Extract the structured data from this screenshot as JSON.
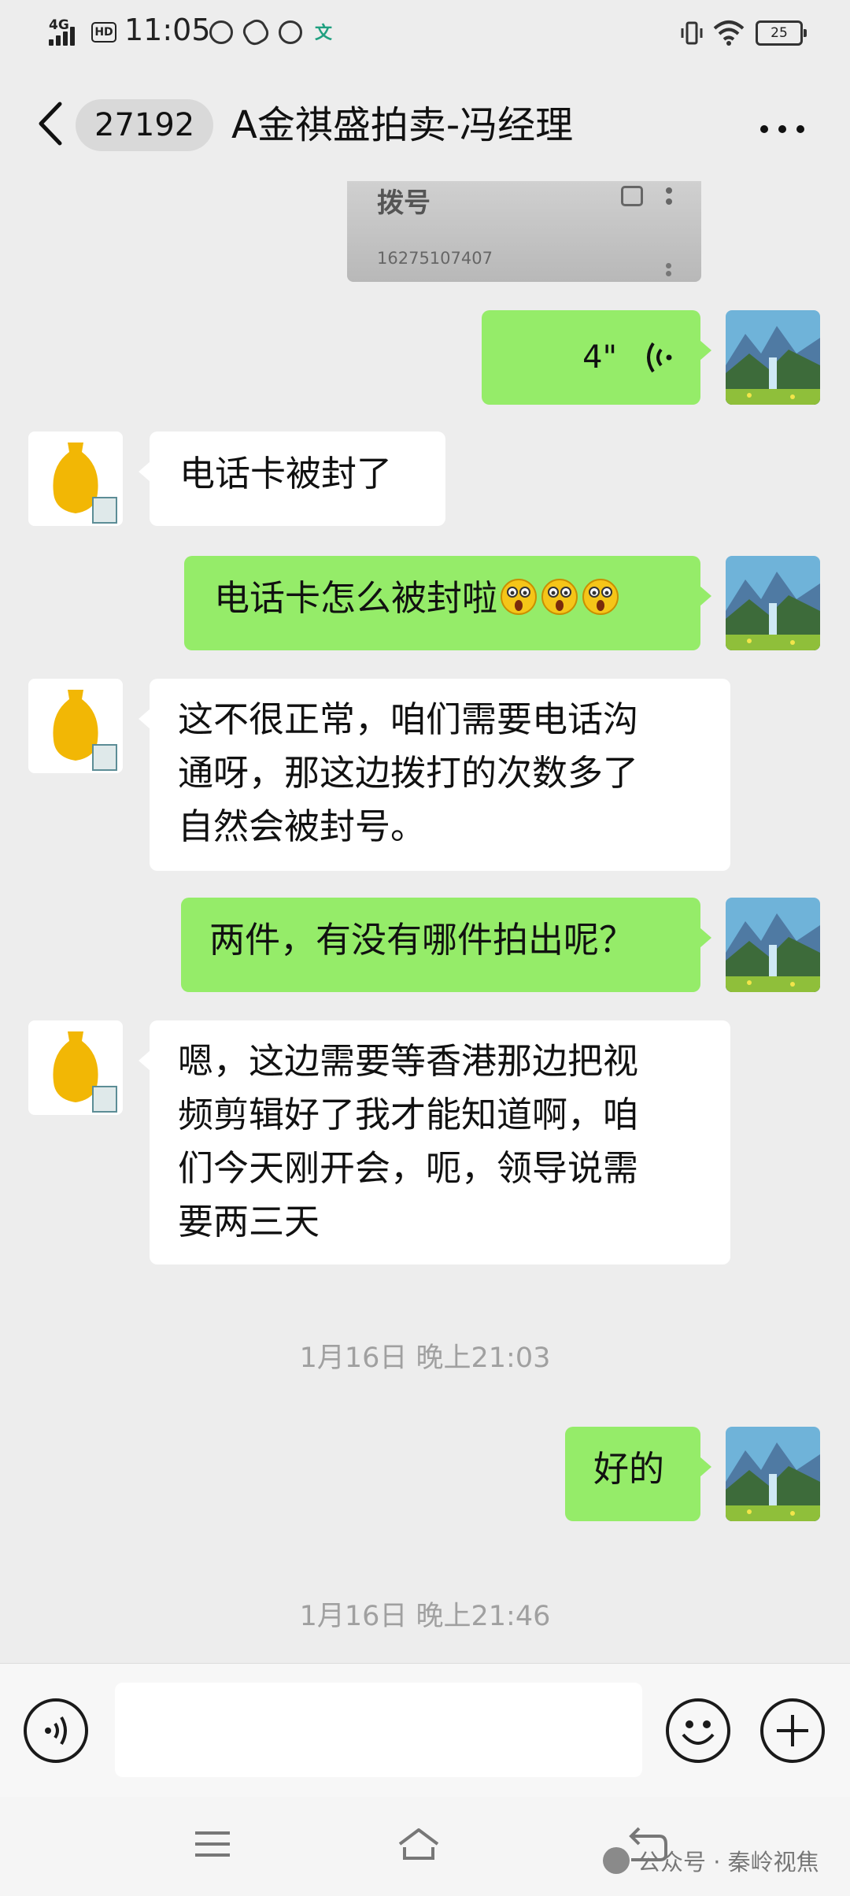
{
  "status_bar": {
    "network": "4G",
    "hd": "HD",
    "time": "11:05",
    "input_method": "文",
    "battery": "25"
  },
  "header": {
    "unread_count": "27192",
    "title": "A金祺盛拍卖-冯经理"
  },
  "messages": [
    {
      "side": "left",
      "sender": "contact",
      "top_image_card": {
        "title": "拨号",
        "number": "16275107407"
      }
    },
    {
      "side": "right",
      "type": "voice",
      "duration": "4\""
    },
    {
      "side": "left",
      "type": "text",
      "text": "电话卡被封了"
    },
    {
      "side": "right",
      "type": "text",
      "text": "电话卡怎么被封啦"
    },
    {
      "side": "left",
      "type": "text",
      "lines": [
        "这不很正常，咱们需要电话沟",
        "通呀，那这边拨打的次数多了",
        "自然会被封号。"
      ]
    },
    {
      "side": "right",
      "type": "text",
      "text": "两件，有没有哪件拍出呢？"
    },
    {
      "side": "left",
      "type": "text",
      "lines": [
        "嗯，这边需要等香港那边把视",
        "频剪辑好了我才能知道啊，咱",
        "们今天刚开会，呃，领导说需",
        "要两三天"
      ]
    },
    {
      "side": "right",
      "type": "text",
      "text": "好的"
    }
  ],
  "card": {
    "title": "拨号",
    "number": "16275107407"
  },
  "voice": {
    "duration": "4\""
  },
  "msg1": "电话卡被封了",
  "msg2": "电话卡怎么被封啦",
  "msg3": {
    "l1": "这不很正常，咱们需要电话沟",
    "l2": "通呀，那这边拨打的次数多了",
    "l3": "自然会被封号。"
  },
  "msg4": "两件，有没有哪件拍出呢？",
  "msg5": {
    "l1": "嗯，这边需要等香港那边把视",
    "l2": "频剪辑好了我才能知道啊，咱",
    "l3": "们今天刚开会，呃，领导说需",
    "l4": "要两三天"
  },
  "msg6": "好的",
  "timestamps": [
    "1月16日 晚上21:03",
    "1月16日 晚上21:46"
  ],
  "input": {
    "value": ""
  },
  "watermark": "公众号 · 秦岭视焦",
  "colors": {
    "background": "#ededed",
    "sent_bubble": "#95ec69",
    "received_bubble": "#ffffff",
    "timestamp": "#a0a0a0"
  }
}
